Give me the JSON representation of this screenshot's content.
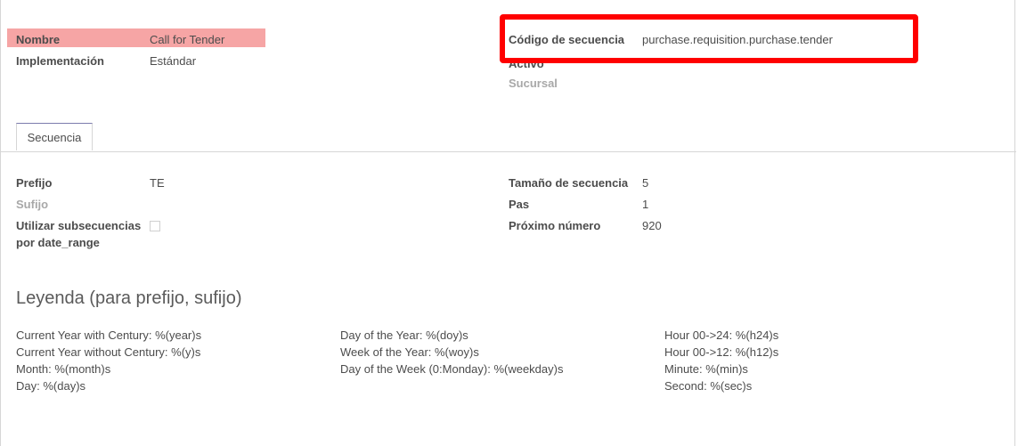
{
  "record": {
    "name_label": "Nombre",
    "name_value": "Call for Tender",
    "impl_label": "Implementación",
    "impl_value": "Estándar",
    "code_label": "Código de secuencia",
    "code_value": "purchase.requisition.purchase.tender",
    "active_label": "Activo",
    "branch_label": "Sucursal"
  },
  "tabs": [
    {
      "label": "Secuencia"
    }
  ],
  "sequence": {
    "prefix_label": "Prefijo",
    "prefix_value": "TE",
    "suffix_label": "Sufijo",
    "subseq_label_1": "Utilizar subsecuencias",
    "subseq_label_2": "por date_range",
    "size_label": "Tamaño de secuencia",
    "size_value": "5",
    "step_label": "Pas",
    "step_value": "1",
    "next_label": "Próximo número",
    "next_value": "920"
  },
  "legend": {
    "title": "Leyenda (para prefijo, sufijo)",
    "col1": [
      "Current Year with Century: %(year)s",
      "Current Year without Century: %(y)s",
      "Month: %(month)s",
      "Day: %(day)s"
    ],
    "col2": [
      "Day of the Year: %(doy)s",
      "Week of the Year: %(woy)s",
      "Day of the Week (0:Monday): %(weekday)s"
    ],
    "col3": [
      "Hour 00->24: %(h24)s",
      "Hour 00->12: %(h12)s",
      "Minute: %(min)s",
      "Second: %(sec)s"
    ]
  },
  "colors": {
    "highlight": "#f6a5a5",
    "annotation_box": "#ff0000",
    "tab_accent": "#7c7bad"
  }
}
